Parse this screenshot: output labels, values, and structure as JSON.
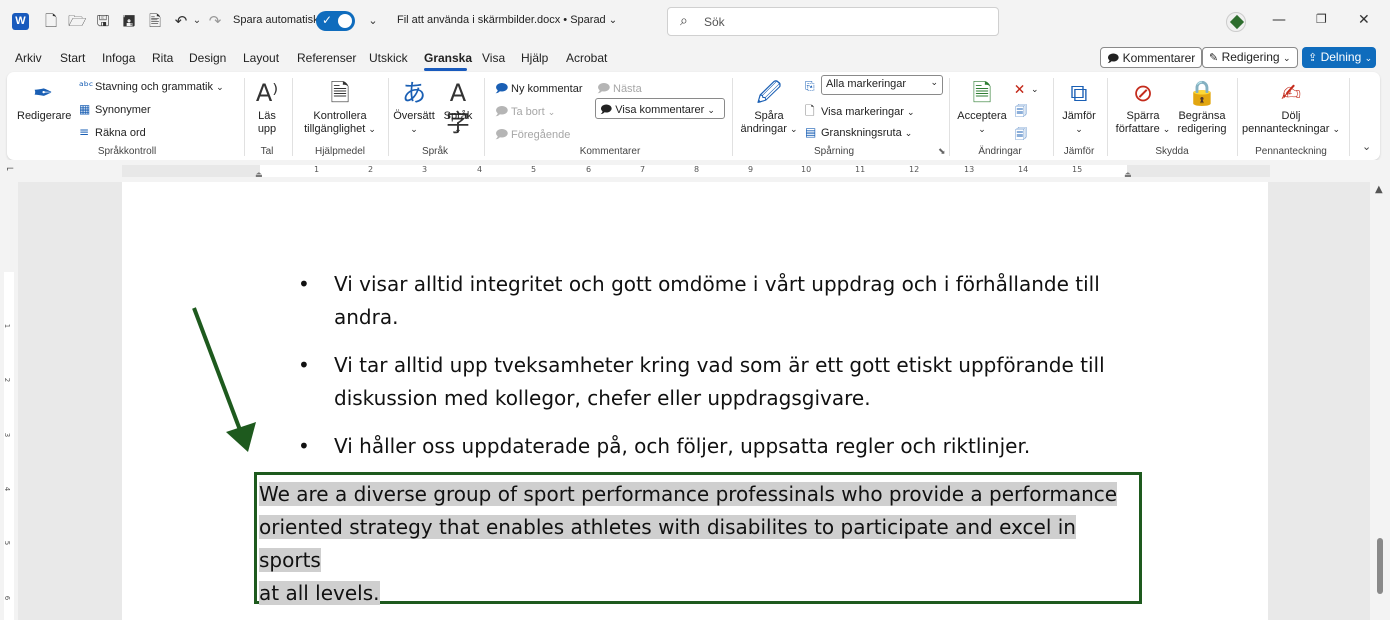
{
  "titlebar": {
    "autosave_label": "Spara automatiskt",
    "document_title": "Fil att använda i skärmbilder.docx • Sparad",
    "search_placeholder": "Sök"
  },
  "menu": {
    "tabs": [
      "Arkiv",
      "Start",
      "Infoga",
      "Rita",
      "Design",
      "Layout",
      "Referenser",
      "Utskick",
      "Granska",
      "Visa",
      "Hjälp",
      "Acrobat"
    ],
    "active_tab": "Granska",
    "comments_button": "Kommentarer",
    "editing_button": "Redigering",
    "share_button": "Delning"
  },
  "ribbon": {
    "proofing": {
      "editor": "Redigerare",
      "spelling": "Stavning och grammatik",
      "thesaurus": "Synonymer",
      "word_count": "Räkna ord",
      "group": "Språkkontroll"
    },
    "speech": {
      "read_aloud_1": "Läs",
      "read_aloud_2": "upp",
      "group": "Tal"
    },
    "accessibility": {
      "check_1": "Kontrollera",
      "check_2": "tillgänglighet",
      "group": "Hjälpmedel"
    },
    "language": {
      "translate": "Översätt",
      "language": "Språk",
      "group": "Språk"
    },
    "comments": {
      "new": "Ny kommentar",
      "delete": "Ta bort",
      "previous": "Föregående",
      "next": "Nästa",
      "show": "Visa kommentarer",
      "group": "Kommentarer"
    },
    "tracking": {
      "track_1": "Spåra",
      "track_2": "ändringar",
      "markup_select": "Alla markeringar",
      "show_markup": "Visa markeringar",
      "review_pane": "Granskningsruta",
      "group": "Spårning"
    },
    "changes": {
      "accept": "Acceptera",
      "group": "Ändringar"
    },
    "compare": {
      "compare": "Jämför",
      "group": "Jämför"
    },
    "protect": {
      "block_1": "Spärra",
      "block_2": "författare",
      "restrict_1": "Begränsa",
      "restrict_2": "redigering",
      "group": "Skydda"
    },
    "ink": {
      "hide_1": "Dölj",
      "hide_2": "pennanteckningar",
      "group": "Pennanteckning"
    }
  },
  "ruler": {
    "numbers": [
      "1",
      "2",
      "3",
      "4",
      "5",
      "6",
      "7",
      "8",
      "9",
      "10",
      "11",
      "12",
      "13",
      "14",
      "15"
    ],
    "vertical_numbers": [
      "1",
      "2",
      "3",
      "4",
      "5",
      "6"
    ]
  },
  "document": {
    "bullets": [
      {
        "line1": "Vi visar alltid integritet och gott omdöme i vårt uppdrag och i förhållande till",
        "line2": "andra."
      },
      {
        "line1": "Vi tar alltid upp tveksamheter kring vad som är ett gott etiskt uppförande till",
        "line2": "diskussion med kollegor, chefer eller uppdragsgivare."
      },
      {
        "line1": "Vi håller oss uppdaterade på, och följer, uppsatta regler och riktlinjer.",
        "line2": ""
      }
    ],
    "selected_lines": [
      "We are a diverse group of sport performance professinals who provide a performance",
      "oriented strategy that enables athletes with disabilites to participate and excel in sports",
      "at all levels."
    ]
  },
  "colors": {
    "accent": "#0f6cbd",
    "annotation_green": "#1e5a1e",
    "selection": "#cfcfcf"
  }
}
